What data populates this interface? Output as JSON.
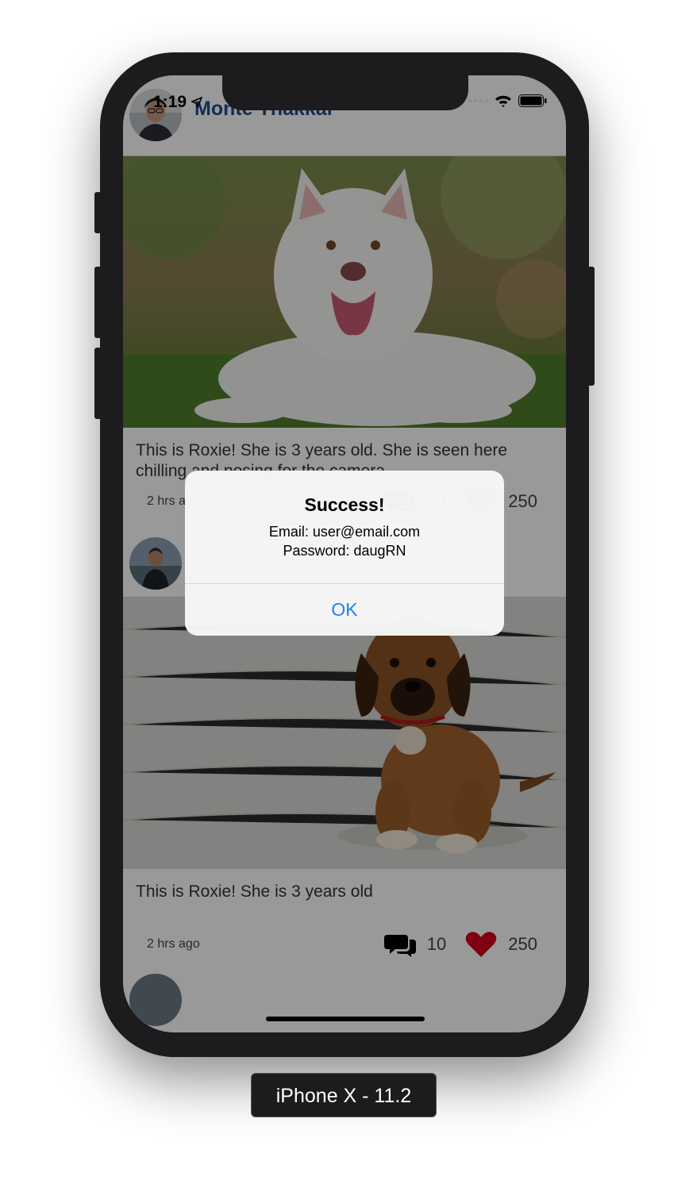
{
  "status_bar": {
    "time": "1:19",
    "location_icon": "location-arrow-icon",
    "wifi_icon": "wifi-icon",
    "battery_icon": "battery-icon"
  },
  "posts": [
    {
      "author": "Monte Thakkar",
      "caption": "This is Roxie! She is 3 years old. She is seen here chilling and posing for the camera",
      "time_ago": "2 hrs ago",
      "comments": "10",
      "likes": "250"
    },
    {
      "author": "",
      "caption": "This is Roxie! She is 3 years old",
      "time_ago": "2 hrs ago",
      "comments": "10",
      "likes": "250"
    }
  ],
  "alert": {
    "title": "Success!",
    "email_line": "Email: user@email.com",
    "password_line": "Password: daugRN",
    "ok_label": "OK"
  },
  "device_label": "iPhone X - 11.2",
  "colors": {
    "author_link": "#1f4e8c",
    "alert_button": "#1a82f8",
    "heart": "#d0021b"
  }
}
